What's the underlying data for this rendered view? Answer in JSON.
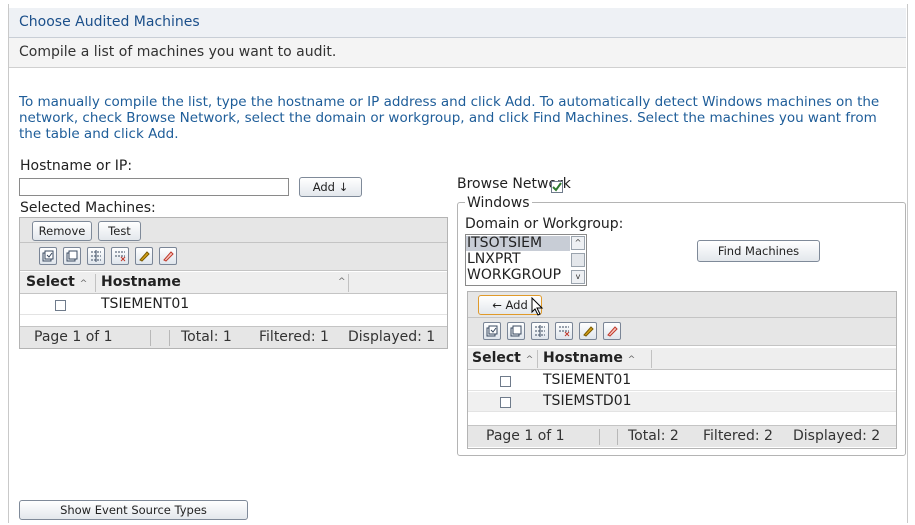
{
  "header": {
    "title": "Choose Audited Machines",
    "subtitle": "Compile a list of machines you want to audit."
  },
  "instructions": "To manually compile the list, type the hostname or IP address and click Add. To automatically detect Windows machines on the network, check Browse Network, select the domain or workgroup, and click Find Machines. Select the machines you want from the table and click Add.",
  "manual": {
    "hostname_label": "Hostname or IP:",
    "hostname_value": "",
    "add_label": "Add ↓",
    "selected_label": "Selected Machines:"
  },
  "selected_table": {
    "remove_label": "Remove",
    "test_label": "Test",
    "columns": [
      "Select",
      "Hostname"
    ],
    "rows": [
      {
        "hostname": "TSIEMENT01",
        "checked": false
      }
    ],
    "footer": {
      "page": "Page 1 of 1",
      "total": "Total: 1",
      "filtered": "Filtered: 1",
      "displayed": "Displayed: 1"
    }
  },
  "browse": {
    "label": "Browse Network",
    "checked": true,
    "legend": "Windows",
    "domain_label": "Domain or Workgroup:",
    "domains": [
      "ITSOTSIEM",
      "LNXPRT",
      "WORKGROUP"
    ],
    "selected_domain": "ITSOTSIEM",
    "find_label": "Find Machines"
  },
  "found_table": {
    "add_label": "← Add",
    "columns": [
      "Select",
      "Hostname"
    ],
    "rows": [
      {
        "hostname": "TSIEMENT01",
        "checked": false
      },
      {
        "hostname": "TSIEMSTD01",
        "checked": false
      }
    ],
    "footer": {
      "page": "Page 1 of 1",
      "total": "Total: 2",
      "filtered": "Filtered: 2",
      "displayed": "Displayed: 2"
    }
  },
  "bottom": {
    "show_event_label": "Show Event Source Types"
  },
  "colors": {
    "title_text": "#1b4f8a",
    "instructions_text": "#1e5d99",
    "checkbox_check": "#2f7a2f",
    "edit_icon": "#d4a017",
    "delete_icon": "#c0392b"
  }
}
